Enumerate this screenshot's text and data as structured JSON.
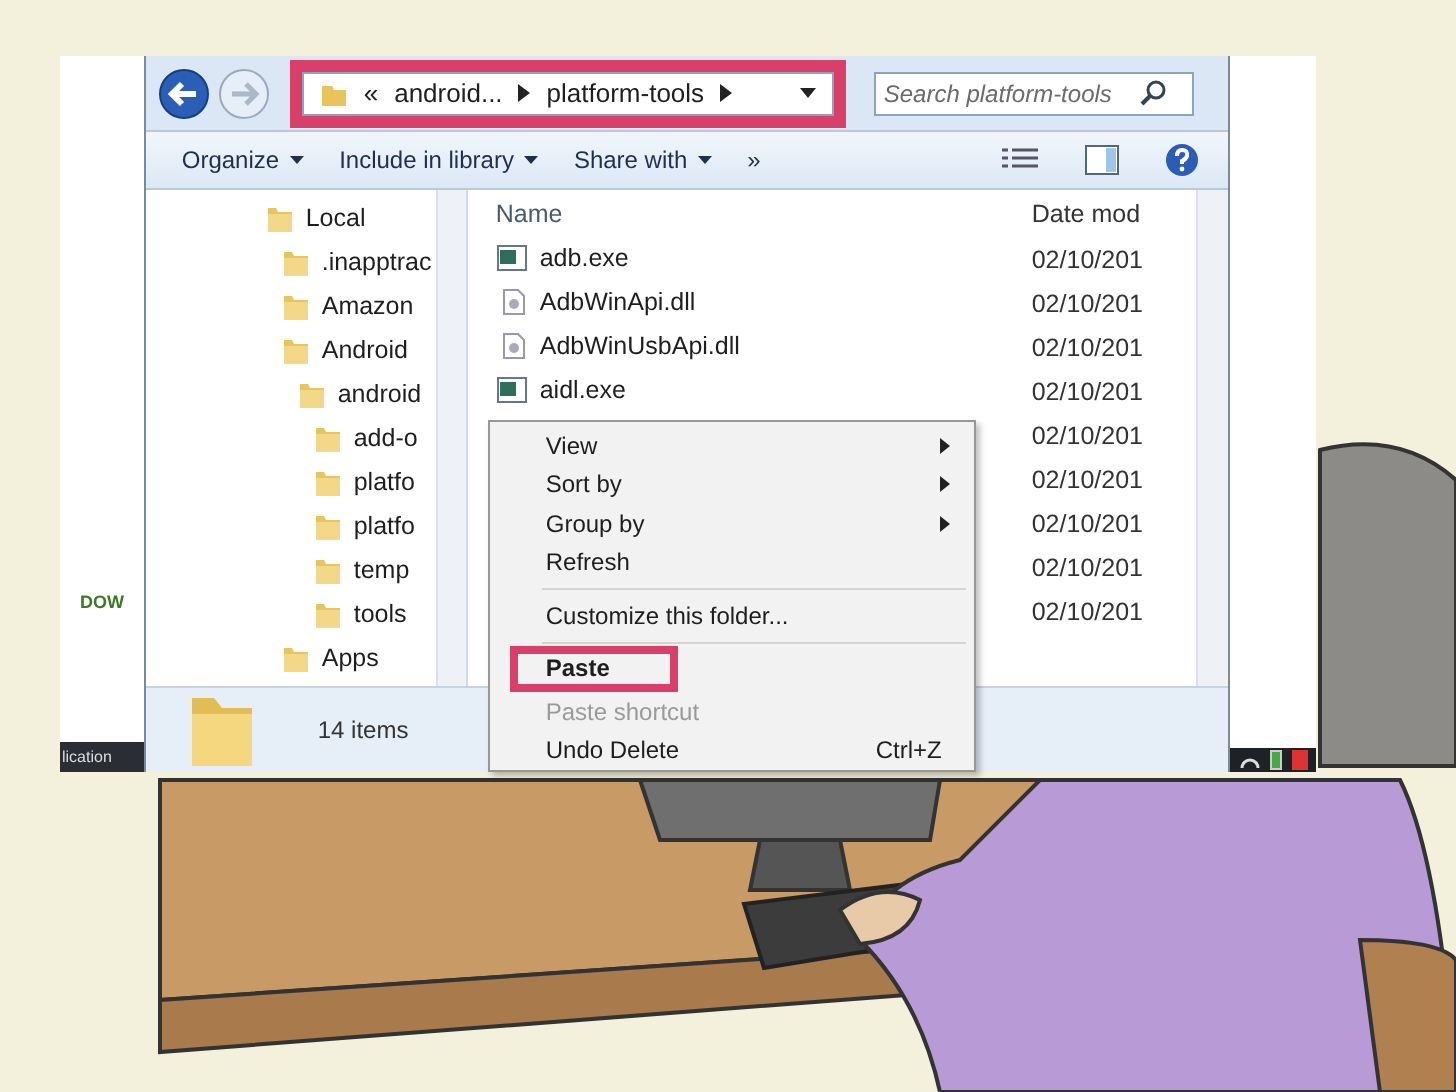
{
  "left_strip": {
    "text": "DOW",
    "taskbar_text": "lication"
  },
  "explorer": {
    "address": {
      "highlighted": true,
      "overflow": "«",
      "crumbs": [
        "android...",
        "platform-tools"
      ]
    },
    "search": {
      "placeholder": "Search platform-tools"
    },
    "toolbar": [
      {
        "label": "Organize"
      },
      {
        "label": "Include in library"
      },
      {
        "label": "Share with"
      }
    ],
    "toolbar_more": "»",
    "tree": [
      {
        "label": "Local",
        "children": [
          {
            "label": ".inapptrac"
          },
          {
            "label": "Amazon"
          },
          {
            "label": "Android",
            "children": [
              {
                "label": "android",
                "children": [
                  {
                    "label": "add-o"
                  },
                  {
                    "label": "platfo"
                  },
                  {
                    "label": "platfo"
                  },
                  {
                    "label": "temp"
                  },
                  {
                    "label": "tools"
                  }
                ]
              }
            ]
          },
          {
            "label": "Apps"
          }
        ]
      }
    ],
    "columns": [
      "Name",
      "Date mod"
    ],
    "files": [
      {
        "name": "adb.exe",
        "kind": "exe",
        "date": "02/10/201"
      },
      {
        "name": "AdbWinApi.dll",
        "kind": "dll",
        "date": "02/10/201"
      },
      {
        "name": "AdbWinUsbApi.dll",
        "kind": "dll",
        "date": "02/10/201"
      },
      {
        "name": "aidl.exe",
        "kind": "exe",
        "date": "02/10/201"
      },
      {
        "date": "02/10/201"
      },
      {
        "date": "02/10/201"
      },
      {
        "date": "02/10/201"
      },
      {
        "date": "02/10/201"
      },
      {
        "date": "02/10/201"
      }
    ],
    "status": "14 items",
    "context_menu": [
      {
        "kind": "item",
        "label": "View",
        "submenu": true,
        "highlighted": false,
        "disabled": false
      },
      {
        "kind": "item",
        "label": "Sort by",
        "submenu": true,
        "highlighted": false,
        "disabled": false
      },
      {
        "kind": "item",
        "label": "Group by",
        "submenu": true,
        "highlighted": false,
        "disabled": false
      },
      {
        "kind": "item",
        "label": "Refresh",
        "submenu": false,
        "highlighted": false,
        "disabled": false
      },
      {
        "kind": "separator"
      },
      {
        "kind": "item",
        "label": "Customize this folder...",
        "submenu": false,
        "highlighted": false,
        "disabled": false
      },
      {
        "kind": "separator"
      },
      {
        "kind": "item",
        "label": "Paste",
        "submenu": false,
        "highlighted": true,
        "disabled": false
      },
      {
        "kind": "item",
        "label": "Paste shortcut",
        "submenu": false,
        "highlighted": false,
        "disabled": true
      },
      {
        "kind": "item",
        "label": "Undo Delete",
        "shortcut": "Ctrl+Z",
        "submenu": false,
        "highlighted": false,
        "disabled": false
      }
    ]
  }
}
